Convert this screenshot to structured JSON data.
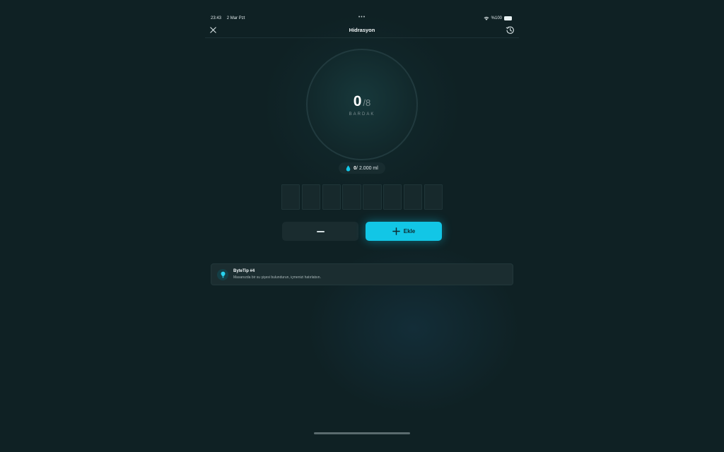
{
  "status_bar": {
    "time": "23:43",
    "date": "2 Mar Pzt",
    "dots": "•••",
    "battery_text": "%100"
  },
  "nav": {
    "title": "Hidrasyon",
    "close_icon": "close-icon",
    "history_icon": "history-icon"
  },
  "progress": {
    "current": "0",
    "separator": "/",
    "goal": "8",
    "unit": "BARDAK",
    "fraction": 0
  },
  "volume": {
    "current_ml": "0",
    "goal_text": "/ 2.000 ml",
    "icon": "water-drop-icon"
  },
  "glasses": {
    "total": 8,
    "filled": 0
  },
  "actions": {
    "add_label": "Ekle"
  },
  "tip": {
    "title": "ByteTip #4",
    "text": "Masanızda bir su şişesi bulundurun, içmenizi hatırlatsın.",
    "icon": "lightbulb-icon"
  },
  "colors": {
    "background": "#0f2124",
    "accent": "#12c6e6",
    "card": "#1b2d30"
  }
}
